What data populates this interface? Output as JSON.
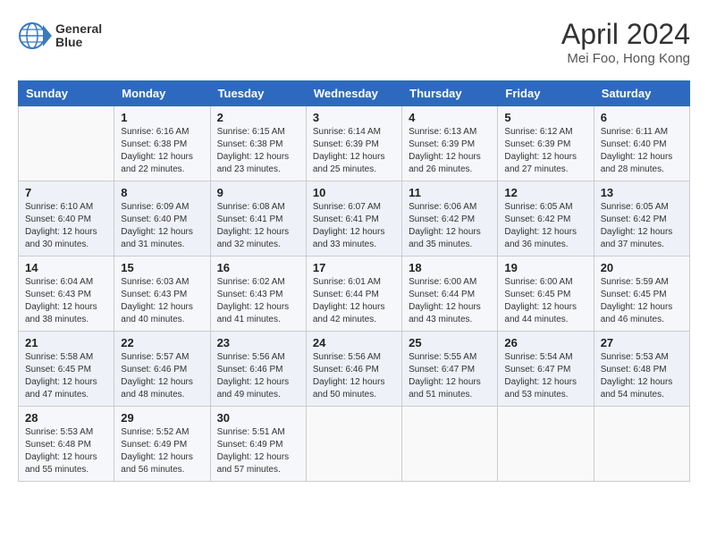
{
  "header": {
    "logo_line1": "General",
    "logo_line2": "Blue",
    "title": "April 2024",
    "subtitle": "Mei Foo, Hong Kong"
  },
  "days_of_week": [
    "Sunday",
    "Monday",
    "Tuesday",
    "Wednesday",
    "Thursday",
    "Friday",
    "Saturday"
  ],
  "weeks": [
    [
      {
        "day": "",
        "info": ""
      },
      {
        "day": "1",
        "info": "Sunrise: 6:16 AM\nSunset: 6:38 PM\nDaylight: 12 hours\nand 22 minutes."
      },
      {
        "day": "2",
        "info": "Sunrise: 6:15 AM\nSunset: 6:38 PM\nDaylight: 12 hours\nand 23 minutes."
      },
      {
        "day": "3",
        "info": "Sunrise: 6:14 AM\nSunset: 6:39 PM\nDaylight: 12 hours\nand 25 minutes."
      },
      {
        "day": "4",
        "info": "Sunrise: 6:13 AM\nSunset: 6:39 PM\nDaylight: 12 hours\nand 26 minutes."
      },
      {
        "day": "5",
        "info": "Sunrise: 6:12 AM\nSunset: 6:39 PM\nDaylight: 12 hours\nand 27 minutes."
      },
      {
        "day": "6",
        "info": "Sunrise: 6:11 AM\nSunset: 6:40 PM\nDaylight: 12 hours\nand 28 minutes."
      }
    ],
    [
      {
        "day": "7",
        "info": "Sunrise: 6:10 AM\nSunset: 6:40 PM\nDaylight: 12 hours\nand 30 minutes."
      },
      {
        "day": "8",
        "info": "Sunrise: 6:09 AM\nSunset: 6:40 PM\nDaylight: 12 hours\nand 31 minutes."
      },
      {
        "day": "9",
        "info": "Sunrise: 6:08 AM\nSunset: 6:41 PM\nDaylight: 12 hours\nand 32 minutes."
      },
      {
        "day": "10",
        "info": "Sunrise: 6:07 AM\nSunset: 6:41 PM\nDaylight: 12 hours\nand 33 minutes."
      },
      {
        "day": "11",
        "info": "Sunrise: 6:06 AM\nSunset: 6:42 PM\nDaylight: 12 hours\nand 35 minutes."
      },
      {
        "day": "12",
        "info": "Sunrise: 6:05 AM\nSunset: 6:42 PM\nDaylight: 12 hours\nand 36 minutes."
      },
      {
        "day": "13",
        "info": "Sunrise: 6:05 AM\nSunset: 6:42 PM\nDaylight: 12 hours\nand 37 minutes."
      }
    ],
    [
      {
        "day": "14",
        "info": "Sunrise: 6:04 AM\nSunset: 6:43 PM\nDaylight: 12 hours\nand 38 minutes."
      },
      {
        "day": "15",
        "info": "Sunrise: 6:03 AM\nSunset: 6:43 PM\nDaylight: 12 hours\nand 40 minutes."
      },
      {
        "day": "16",
        "info": "Sunrise: 6:02 AM\nSunset: 6:43 PM\nDaylight: 12 hours\nand 41 minutes."
      },
      {
        "day": "17",
        "info": "Sunrise: 6:01 AM\nSunset: 6:44 PM\nDaylight: 12 hours\nand 42 minutes."
      },
      {
        "day": "18",
        "info": "Sunrise: 6:00 AM\nSunset: 6:44 PM\nDaylight: 12 hours\nand 43 minutes."
      },
      {
        "day": "19",
        "info": "Sunrise: 6:00 AM\nSunset: 6:45 PM\nDaylight: 12 hours\nand 44 minutes."
      },
      {
        "day": "20",
        "info": "Sunrise: 5:59 AM\nSunset: 6:45 PM\nDaylight: 12 hours\nand 46 minutes."
      }
    ],
    [
      {
        "day": "21",
        "info": "Sunrise: 5:58 AM\nSunset: 6:45 PM\nDaylight: 12 hours\nand 47 minutes."
      },
      {
        "day": "22",
        "info": "Sunrise: 5:57 AM\nSunset: 6:46 PM\nDaylight: 12 hours\nand 48 minutes."
      },
      {
        "day": "23",
        "info": "Sunrise: 5:56 AM\nSunset: 6:46 PM\nDaylight: 12 hours\nand 49 minutes."
      },
      {
        "day": "24",
        "info": "Sunrise: 5:56 AM\nSunset: 6:46 PM\nDaylight: 12 hours\nand 50 minutes."
      },
      {
        "day": "25",
        "info": "Sunrise: 5:55 AM\nSunset: 6:47 PM\nDaylight: 12 hours\nand 51 minutes."
      },
      {
        "day": "26",
        "info": "Sunrise: 5:54 AM\nSunset: 6:47 PM\nDaylight: 12 hours\nand 53 minutes."
      },
      {
        "day": "27",
        "info": "Sunrise: 5:53 AM\nSunset: 6:48 PM\nDaylight: 12 hours\nand 54 minutes."
      }
    ],
    [
      {
        "day": "28",
        "info": "Sunrise: 5:53 AM\nSunset: 6:48 PM\nDaylight: 12 hours\nand 55 minutes."
      },
      {
        "day": "29",
        "info": "Sunrise: 5:52 AM\nSunset: 6:49 PM\nDaylight: 12 hours\nand 56 minutes."
      },
      {
        "day": "30",
        "info": "Sunrise: 5:51 AM\nSunset: 6:49 PM\nDaylight: 12 hours\nand 57 minutes."
      },
      {
        "day": "",
        "info": ""
      },
      {
        "day": "",
        "info": ""
      },
      {
        "day": "",
        "info": ""
      },
      {
        "day": "",
        "info": ""
      }
    ]
  ]
}
